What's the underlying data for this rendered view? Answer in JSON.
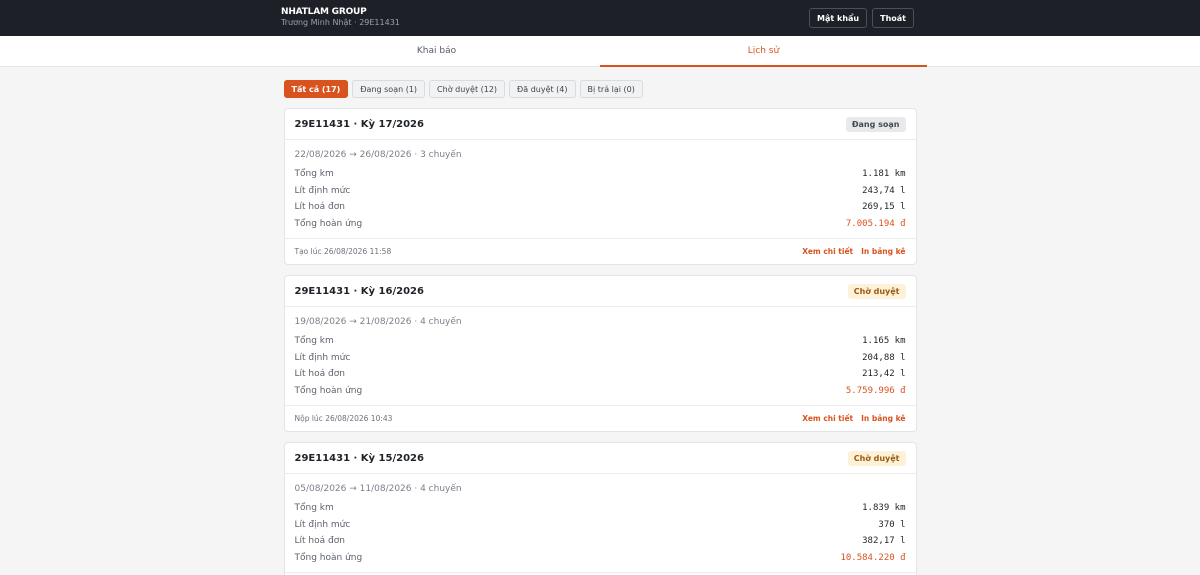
{
  "header": {
    "brand": "NHATLAM GROUP",
    "subtitle": "Trương Minh Nhật · 29E11431",
    "buttons": {
      "password": "Mật khẩu",
      "logout": "Thoát"
    }
  },
  "tabs": [
    {
      "label": "Khai báo",
      "active": false
    },
    {
      "label": "Lịch sử",
      "active": true
    }
  ],
  "filters": [
    {
      "label": "Tất cả (17)",
      "active": true
    },
    {
      "label": "Đang soạn (1)",
      "active": false
    },
    {
      "label": "Chờ duyệt (12)",
      "active": false
    },
    {
      "label": "Đã duyệt (4)",
      "active": false
    },
    {
      "label": "Bị trả lại (0)",
      "active": false
    }
  ],
  "labels": {
    "total_km": "Tổng km",
    "liters_norm": "Lít định mức",
    "liters_invoice": "Lít hoá đơn",
    "total_refund": "Tổng hoàn ứng",
    "view_detail": "Xem chi tiết",
    "print": "In bảng kê"
  },
  "accent_color": "#d9531e",
  "records": [
    {
      "title": "29E11431 · Kỳ 17/2026",
      "status": "Đang soạn",
      "status_type": "draft",
      "period": "22/08/2026 → 26/08/2026 · 3 chuyến",
      "total_km": "1.181 km",
      "liters_norm": "243,74 l",
      "liters_invoice": "269,15 l",
      "total_refund": "7.005.194 đ",
      "timestamp": "Tạo lúc 26/08/2026 11:58"
    },
    {
      "title": "29E11431 · Kỳ 16/2026",
      "status": "Chờ duyệt",
      "status_type": "pending",
      "period": "19/08/2026 → 21/08/2026 · 4 chuyến",
      "total_km": "1.165 km",
      "liters_norm": "204,88 l",
      "liters_invoice": "213,42 l",
      "total_refund": "5.759.996 đ",
      "timestamp": "Nộp lúc 26/08/2026 10:43"
    },
    {
      "title": "29E11431 · Kỳ 15/2026",
      "status": "Chờ duyệt",
      "status_type": "pending",
      "period": "05/08/2026 → 11/08/2026 · 4 chuyến",
      "total_km": "1.839 km",
      "liters_norm": "370 l",
      "liters_invoice": "382,17 l",
      "total_refund": "10.584.220 đ",
      "timestamp": ""
    }
  ]
}
